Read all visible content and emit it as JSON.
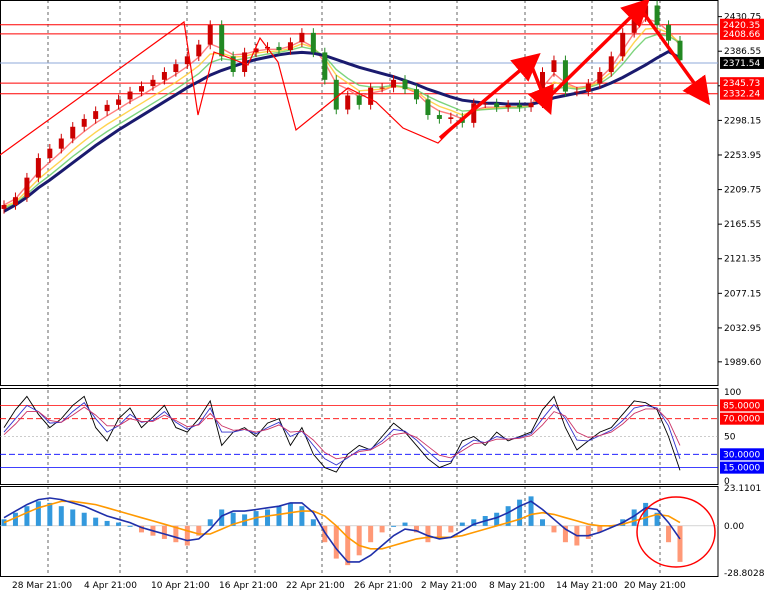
{
  "chart_data": {
    "type": "line",
    "subject": "",
    "x_labels": [
      "28 Mar 21:00",
      "4 Apr 21:00",
      "10 Apr 21:00",
      "16 Apr 21:00",
      "22 Apr 21:00",
      "26 Apr 21:00",
      "2 May 21:00",
      "8 May 21:00",
      "14 May 21:00",
      "20 May 21:00"
    ],
    "price_panel": {
      "ylim": [
        1960,
        2452
      ],
      "y_ticks": [
        "2430.75",
        "2386.55",
        "2342.35",
        "2298.15",
        "2253.95",
        "2209.75",
        "2165.55",
        "2121.35",
        "2077.15",
        "2032.95",
        "1989.60"
      ],
      "price_tags": [
        {
          "value": 2420.35,
          "label": "2420.35",
          "color": "#ff0000"
        },
        {
          "value": 2408.66,
          "label": "2408.66",
          "color": "#ff0000"
        },
        {
          "value": 2371.54,
          "label": "2371.54",
          "color": "#000000"
        },
        {
          "value": 2345.73,
          "label": "2345.73",
          "color": "#ff0000"
        },
        {
          "value": 2332.24,
          "label": "2332.24",
          "color": "#ff0000"
        }
      ],
      "horizontal_lines": [
        {
          "value": 2420.35,
          "color": "#ff0000"
        },
        {
          "value": 2408.66,
          "color": "#ff0000"
        },
        {
          "value": 2371.54,
          "color": "#8fa8d8"
        },
        {
          "value": 2345.73,
          "color": "#ff0000"
        },
        {
          "value": 2332.24,
          "color": "#ff0000"
        }
      ],
      "close_series": [
        2190,
        2200,
        2225,
        2250,
        2262,
        2275,
        2290,
        2300,
        2310,
        2318,
        2325,
        2335,
        2342,
        2350,
        2360,
        2370,
        2380,
        2395,
        2420,
        2380,
        2360,
        2385,
        2390,
        2392,
        2388,
        2398,
        2410,
        2385,
        2350,
        2312,
        2330,
        2318,
        2340,
        2340,
        2350,
        2338,
        2325,
        2305,
        2300,
        2302,
        2295,
        2320,
        2320,
        2315,
        2318,
        2315,
        2320,
        2360,
        2375,
        2335,
        2335,
        2345,
        2360,
        2380,
        2410,
        2430,
        2445,
        2420,
        2400,
        2375
      ],
      "ma_slow": [
        2182,
        2190,
        2200,
        2212,
        2222,
        2233,
        2244,
        2255,
        2266,
        2276,
        2286,
        2295,
        2304,
        2313,
        2322,
        2331,
        2340,
        2348,
        2356,
        2362,
        2367,
        2372,
        2376,
        2379,
        2382,
        2384,
        2385,
        2384,
        2381,
        2376,
        2371,
        2366,
        2362,
        2358,
        2354,
        2349,
        2344,
        2338,
        2333,
        2328,
        2324,
        2322,
        2320,
        2320,
        2319,
        2319,
        2319,
        2322,
        2327,
        2330,
        2333,
        2336,
        2340,
        2346,
        2353,
        2361,
        2369,
        2378,
        2386,
        2378
      ],
      "envelope_series": [
        [
          2190,
          2198,
          2215,
          2232,
          2245,
          2258,
          2272,
          2284,
          2295,
          2304,
          2313,
          2322,
          2330,
          2339,
          2348,
          2357,
          2367,
          2379,
          2396,
          2390,
          2382,
          2383,
          2387,
          2389,
          2389,
          2393,
          2400,
          2392,
          2372,
          2345,
          2338,
          2328,
          2333,
          2336,
          2342,
          2340,
          2333,
          2319,
          2310,
          2306,
          2300,
          2311,
          2315,
          2315,
          2316,
          2315,
          2318,
          2340,
          2358,
          2346,
          2340,
          2342,
          2352,
          2366,
          2388,
          2410,
          2428,
          2424,
          2412,
          2394
        ],
        [
          2188,
          2194,
          2208,
          2223,
          2235,
          2247,
          2260,
          2272,
          2283,
          2293,
          2302,
          2311,
          2320,
          2329,
          2338,
          2347,
          2357,
          2368,
          2383,
          2384,
          2379,
          2380,
          2384,
          2386,
          2387,
          2390,
          2396,
          2391,
          2377,
          2356,
          2346,
          2336,
          2337,
          2338,
          2342,
          2340,
          2335,
          2324,
          2316,
          2311,
          2305,
          2310,
          2313,
          2314,
          2315,
          2315,
          2317,
          2332,
          2347,
          2343,
          2339,
          2341,
          2348,
          2360,
          2378,
          2398,
          2415,
          2416,
          2410,
          2397
        ],
        [
          2186,
          2192,
          2204,
          2217,
          2228,
          2240,
          2252,
          2263,
          2274,
          2284,
          2293,
          2302,
          2311,
          2320,
          2329,
          2338,
          2348,
          2358,
          2372,
          2377,
          2375,
          2377,
          2380,
          2383,
          2385,
          2388,
          2392,
          2389,
          2380,
          2363,
          2352,
          2343,
          2341,
          2341,
          2343,
          2341,
          2337,
          2329,
          2322,
          2316,
          2310,
          2311,
          2312,
          2313,
          2314,
          2314,
          2316,
          2327,
          2339,
          2340,
          2338,
          2340,
          2345,
          2355,
          2370,
          2388,
          2403,
          2408,
          2406,
          2397
        ]
      ]
    },
    "oscillator_panel": {
      "ylim": [
        0,
        100
      ],
      "y_ticks": [
        "100",
        "50",
        "0"
      ],
      "levels": [
        {
          "value": 85,
          "label": "85.0000",
          "color": "#ff0000"
        },
        {
          "value": 70,
          "label": "70.0000",
          "color": "#ff0000"
        },
        {
          "value": 30,
          "label": "30.0000",
          "color": "#0000ff"
        },
        {
          "value": 15,
          "label": "15.0000",
          "color": "#0000ff"
        }
      ],
      "series": [
        {
          "color": "#000000",
          "values": [
            60,
            80,
            95,
            75,
            60,
            70,
            85,
            95,
            60,
            45,
            70,
            82,
            60,
            72,
            85,
            60,
            55,
            70,
            90,
            40,
            55,
            60,
            50,
            65,
            70,
            40,
            60,
            30,
            15,
            10,
            30,
            40,
            35,
            50,
            65,
            55,
            40,
            25,
            15,
            20,
            45,
            50,
            40,
            55,
            45,
            50,
            55,
            80,
            95,
            60,
            35,
            45,
            55,
            60,
            75,
            90,
            88,
            80,
            50,
            12
          ]
        },
        {
          "color": "#3333cc",
          "values": [
            55,
            70,
            85,
            78,
            65,
            66,
            78,
            88,
            70,
            55,
            62,
            75,
            66,
            68,
            78,
            66,
            58,
            64,
            82,
            55,
            55,
            58,
            53,
            60,
            66,
            50,
            56,
            40,
            25,
            18,
            26,
            35,
            36,
            45,
            58,
            56,
            46,
            33,
            22,
            22,
            38,
            46,
            43,
            50,
            47,
            49,
            53,
            70,
            86,
            70,
            46,
            45,
            51,
            57,
            68,
            82,
            85,
            82,
            62,
            25
          ]
        },
        {
          "color": "#cc3366",
          "values": [
            52,
            64,
            78,
            78,
            68,
            66,
            74,
            83,
            74,
            62,
            62,
            70,
            67,
            67,
            74,
            68,
            61,
            63,
            76,
            62,
            57,
            58,
            55,
            58,
            63,
            55,
            56,
            46,
            32,
            25,
            27,
            33,
            35,
            42,
            52,
            54,
            49,
            39,
            29,
            26,
            34,
            42,
            43,
            47,
            47,
            48,
            51,
            63,
            78,
            73,
            55,
            49,
            51,
            55,
            64,
            76,
            81,
            81,
            68,
            40
          ]
        }
      ]
    },
    "macd_panel": {
      "ylim": [
        -28.8028,
        23.1101
      ],
      "y_ticks": [
        "23.1101",
        "0.00",
        "-28.8028"
      ],
      "histogram": [
        4,
        8,
        12,
        15,
        14,
        12,
        10,
        8,
        5,
        3,
        2,
        0,
        -4,
        -6,
        -8,
        -10,
        -12,
        -6,
        4,
        10,
        8,
        7,
        9,
        10,
        12,
        14,
        12,
        4,
        -10,
        -20,
        -24,
        -18,
        -10,
        -4,
        0,
        2,
        -4,
        -10,
        -8,
        -4,
        2,
        4,
        6,
        8,
        12,
        16,
        18,
        4,
        -4,
        -10,
        -12,
        -8,
        -4,
        0,
        4,
        10,
        14,
        8,
        -10,
        -22
      ],
      "macd_line": [
        5,
        9,
        13,
        16,
        17,
        16,
        14,
        12,
        9,
        6,
        4,
        2,
        -1,
        -3,
        -5,
        -7,
        -9,
        -8,
        -2,
        6,
        9,
        9,
        10,
        11,
        12,
        14,
        14,
        8,
        -4,
        -14,
        -22,
        -22,
        -18,
        -12,
        -6,
        -2,
        -3,
        -6,
        -8,
        -7,
        -3,
        1,
        3,
        5,
        8,
        12,
        15,
        10,
        4,
        -2,
        -6,
        -6,
        -4,
        -1,
        2,
        6,
        11,
        10,
        2,
        -8
      ],
      "signal_line": [
        2,
        5,
        8,
        11,
        13,
        15,
        15,
        14,
        13,
        11,
        9,
        7,
        5,
        3,
        1,
        -1,
        -3,
        -5,
        -5,
        -2,
        1,
        3,
        5,
        6,
        7,
        8,
        9,
        9,
        6,
        0,
        -7,
        -12,
        -14,
        -14,
        -12,
        -10,
        -8,
        -7,
        -7,
        -7,
        -6,
        -4,
        -2,
        0,
        2,
        4,
        7,
        8,
        7,
        5,
        3,
        1,
        0,
        0,
        1,
        3,
        5,
        7,
        6,
        2
      ]
    },
    "annotations": {
      "arrows": "red trend arrows drawn on price panel",
      "circle": "red ellipse around latest MACD histogram bars"
    }
  },
  "colors": {
    "background": "#ffffff",
    "bull_candle": "#cc0000",
    "bear_candle": "#228822",
    "ma_slow": "#1a1a6e",
    "hist_pos": "#3399dd",
    "hist_neg": "#ff9977",
    "macd_line": "#1f2faa",
    "signal_line": "#ff9900",
    "annotation": "#ff0000"
  }
}
